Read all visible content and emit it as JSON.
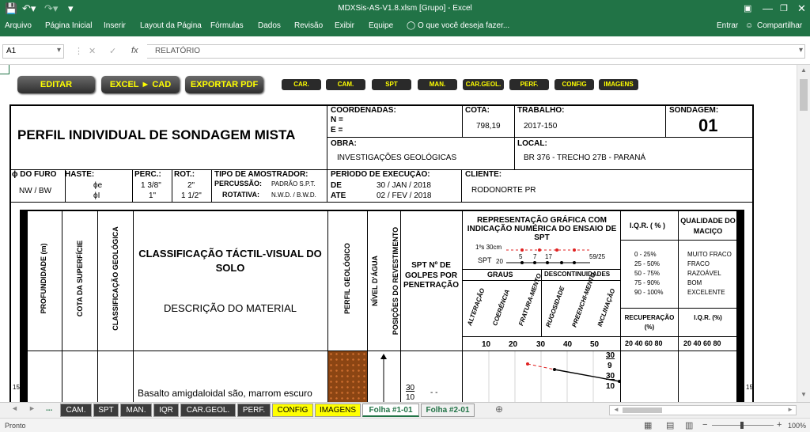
{
  "titlebar": {
    "title": "MDXSis-AS-V1.8.xlsm  [Grupo] - Excel"
  },
  "ribbon": {
    "tabs": [
      "Arquivo",
      "Página Inicial",
      "Inserir",
      "Layout da Página",
      "Fórmulas",
      "Dados",
      "Revisão",
      "Exibir",
      "Equipe"
    ],
    "tell_me": "O que você deseja fazer...",
    "signin": "Entrar",
    "share": "Compartilhar"
  },
  "formula_bar": {
    "cell": "A1",
    "fx": "fx",
    "value": "RELATÓRIO"
  },
  "buttons": {
    "main": [
      "EDITAR",
      "EXCEL ► CAD",
      "EXPORTAR PDF"
    ],
    "small": [
      "CAR.",
      "CAM.",
      "SPT",
      "MAN.",
      "CAR.GEOL.",
      "PERF.",
      "CONFIG",
      "IMAGENS"
    ]
  },
  "report": {
    "title": "PERFIL INDIVIDUAL DE SONDAGEM MISTA",
    "coordenadas_label": "COORDENADAS:",
    "n_label": "N =",
    "e_label": "E =",
    "cota_label": "COTA:",
    "cota_value": "798,19",
    "trabalho_label": "TRABALHO:",
    "trabalho_value": "2017-150",
    "sondagem_label": "SONDAGEM:",
    "sondagem_value": "01",
    "obra_label": "OBRA:",
    "obra_value": "INVESTIGAÇÕES GEOLÓGICAS",
    "local_label": "LOCAL:",
    "local_value": "BR 376 - TRECHO 27B - PARANÁ",
    "furo_label": "ϕ DO FURO",
    "furo_value": "NW / BW",
    "haste_label": "HASTE:",
    "haste_e": "ϕe",
    "haste_i": "ϕI",
    "perc_label": "PERC.:",
    "perc_e": "1 3/8\"",
    "perc_i": "1\"",
    "rot_label": "ROT.:",
    "rot_e": "2\"",
    "rot_i": "1 1/2\"",
    "amostrador_label": "TIPO DE AMOSTRADOR:",
    "percussao_label": "PERCUSSÃO:",
    "percussao_value": "PADRÃO S.P.T.",
    "rotativa_label": "ROTATIVA:",
    "rotativa_value": "N.W.D. / B.W.D.",
    "periodo_label": "PERÍODO DE EXECUÇÃO:",
    "de_label": "DE",
    "de_value": "30 / JAN / 2018",
    "ate_label": "ATE",
    "ate_value": "02 / FEV / 2018",
    "cliente_label": "CLIENTE:",
    "cliente_value": "RODONORTE PR"
  },
  "columns": {
    "profundidade": "PROFUNDIDADE (m)",
    "cota": "COTA DA SUPERFÍCIE",
    "class_geo": "CLASSIFICAÇÃO GEOLÓGICA",
    "class_tactil": "CLASSIFICAÇÃO TÁCTIL-VISUAL DO SOLO",
    "descricao": "DESCRIÇÃO DO MATERIAL",
    "perfil_geo": "PERFIL GEOLÓGICO",
    "nivel_agua": "NÍVEL D'ÁGUA",
    "posicoes": "POSIÇÕES DO REVESTIMENTO",
    "spt": "SPT Nº DE GOLPES POR PENETRAÇÃO",
    "repr": "REPRESENTAÇÃO GRÁFICA COM INDICAÇÃO NUMÉRICA DO ENSAIO DE SPT",
    "legend_1": "1ºs 30cm",
    "legend_spt": "SPT",
    "legend_start": "20",
    "legend_vals": [
      "5",
      "7",
      "17"
    ],
    "legend_end": "59/25",
    "graus": "GRAUS",
    "descontinuidades": "DESCONTINUIDADES",
    "sub": [
      "ALTERAÇÃO",
      "COERÊNCIA",
      "FRATURA-MENTO",
      "RUGOSIDADE",
      "PREENCHI-MENTO",
      "INCLINAÇÃO"
    ],
    "scale": [
      "10",
      "20",
      "30",
      "40",
      "50"
    ],
    "iqr_label": "I.Q.R. ( % )",
    "iqr_ranges": [
      "0  - 25%",
      "25 - 50%",
      "50 - 75%",
      "75 - 90%",
      "90 - 100%"
    ],
    "qualidade_label": "QUALIDADE DO MACIÇO",
    "qualidade": [
      "MUITO FRACO",
      "FRACO",
      "RAZOÁVEL",
      "BOM",
      "EXCELENTE"
    ],
    "recuperacao": "RECUPERAÇÃO (%)",
    "iqr_pct": "I.Q.R. (%)",
    "scale2": "20 40 60 80",
    "scale3": "20 40 60 80"
  },
  "row1": {
    "depth": "15",
    "descr": "Basalto amigdaloidal são, marrom escuro",
    "spt_frac_top": "30",
    "spt_frac_bot": "10",
    "dash": "-    -",
    "vals": [
      "30",
      "9",
      "30",
      "10"
    ]
  },
  "sheet_tabs": [
    "...",
    "CAM.",
    "SPT",
    "MAN.",
    "IQR",
    "CAR.GEOL.",
    "PERF.",
    "CONFIG",
    "IMAGENS",
    "Folha #1-01",
    "Folha #2-01"
  ],
  "status": {
    "left": "Pronto",
    "zoom": "100%"
  },
  "colors": {
    "excel_green": "#217346",
    "button_yellow": "#ffff00",
    "profile_brown": "#8b4513",
    "spt_red": "#e02020"
  }
}
